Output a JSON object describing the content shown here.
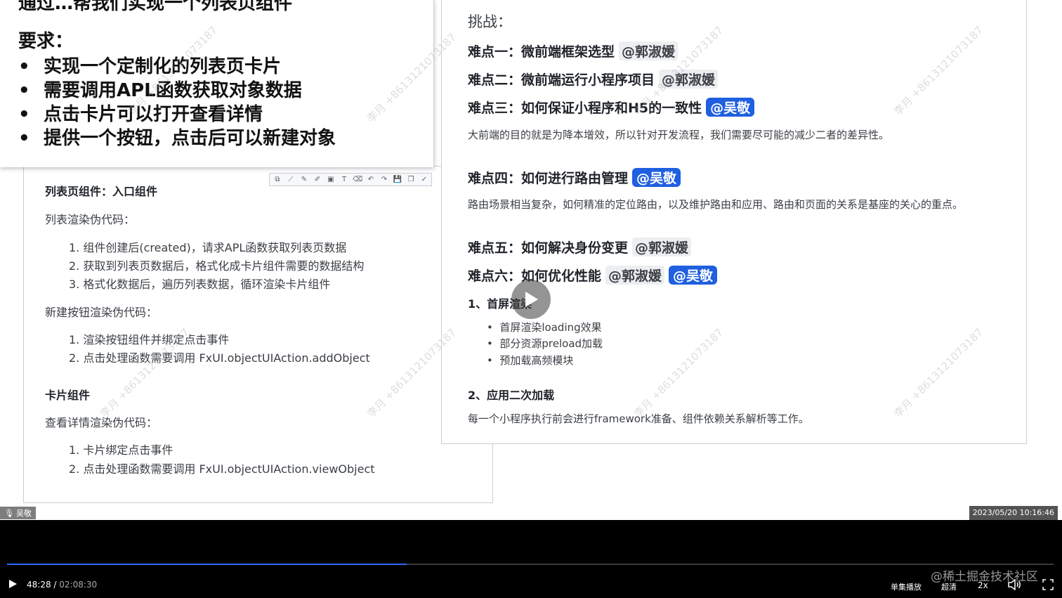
{
  "requirement_card": {
    "top_partial": "通过…帮我们实现一个列表页组件",
    "title": "要求：",
    "items": [
      "实现一个定制化的列表页卡片",
      "需要调用APL函数获取对象数据",
      "点击卡片可以打开查看详情",
      "提供一个按钮，点击后可以新建对象"
    ]
  },
  "left_doc": {
    "section1_title": "列表页组件：入口组件",
    "list_render_label": "列表渲染伪代码：",
    "list_render_steps": [
      "1. 组件创建后(created)，请求APL函数获取列表页数据",
      "2. 获取到列表页数据后，格式化成卡片组件需要的数据结构",
      "3. 格式化数据后，遍历列表数据，循环渲染卡片组件"
    ],
    "new_button_label": "新建按钮渲染伪代码：",
    "new_button_steps": [
      "1. 渲染按钮组件并绑定点击事件",
      "2. 点击处理函数需要调用 FxUI.objectUIAction.addObject"
    ],
    "section2_title": "卡片组件",
    "detail_label": "查看详情渲染伪代码：",
    "detail_steps": [
      "1. 卡片绑定点击事件",
      "2. 点击处理函数需要调用 FxUI.objectUIAction.viewObject"
    ]
  },
  "toolbar_icons": [
    "select-icon",
    "line-icon",
    "pen-icon",
    "highlighter-icon",
    "rect-icon",
    "text-icon",
    "eraser-icon",
    "undo-icon",
    "redo-icon",
    "save-icon",
    "copy-icon",
    "confirm-icon"
  ],
  "toolbar_glyphs": [
    "⧉",
    "⟋",
    "✎",
    "✐",
    "▣",
    "T",
    "⌫",
    "↶",
    "↷",
    "💾",
    "❐",
    "✓"
  ],
  "right_doc": {
    "challenge_label": "挑战：",
    "points": [
      {
        "title": "难点一：微前端框架选型",
        "mentions": [
          {
            "name": "@郭淑媛",
            "style": "gray"
          }
        ]
      },
      {
        "title": "难点二：微前端运行小程序项目",
        "mentions": [
          {
            "name": "@郭淑媛",
            "style": "gray"
          }
        ]
      },
      {
        "title": "难点三：如何保证小程序和H5的一致性",
        "mentions": [
          {
            "name": "@吴敬",
            "style": "blue"
          }
        ]
      },
      {
        "title": "难点四：如何进行路由管理",
        "mentions": [
          {
            "name": "@吴敬",
            "style": "blue"
          }
        ]
      },
      {
        "title": "难点五：如何解决身份变更",
        "mentions": [
          {
            "name": "@郭淑媛",
            "style": "gray"
          }
        ]
      },
      {
        "title": "难点六：如何优化性能",
        "mentions": [
          {
            "name": "@郭淑媛",
            "style": "gray"
          },
          {
            "name": "@吴敬",
            "style": "blue"
          }
        ]
      }
    ],
    "point3_desc": "大前端的目的就是为降本增效，所以针对开发流程，我们需要尽可能的减少二者的差异性。",
    "point4_desc": "路由场景相当复杂，如何精准的定位路由，以及维护路由和应用、路由和页面的关系是基座的关心的重点。",
    "perf_sub1": "1、首屏渲染",
    "perf_sub1_items": [
      "首屏渲染loading效果",
      "部分资源preload加载",
      "预加载高频模块"
    ],
    "perf_sub2": "2、应用二次加载",
    "perf_sub2_desc": "每一个小程序执行前会进行framework准备、组件依赖关系解析等工作。"
  },
  "watermark": "李月 +8613121073187",
  "overlay": {
    "speaker": "吴敬",
    "timestamp": "2023/05/20 10:16:46"
  },
  "player": {
    "current_time": "48:28",
    "separator": " / ",
    "duration": "02:08:30",
    "progress_fraction": 0.382,
    "single_play": "单集播放",
    "quality": "超清",
    "speed": "2x",
    "brand": "@稀土掘金技术社区"
  },
  "colors": {
    "accent_blue": "#1f5fe0",
    "progress_blue": "#2c6bff",
    "player_bg": "#000000"
  }
}
